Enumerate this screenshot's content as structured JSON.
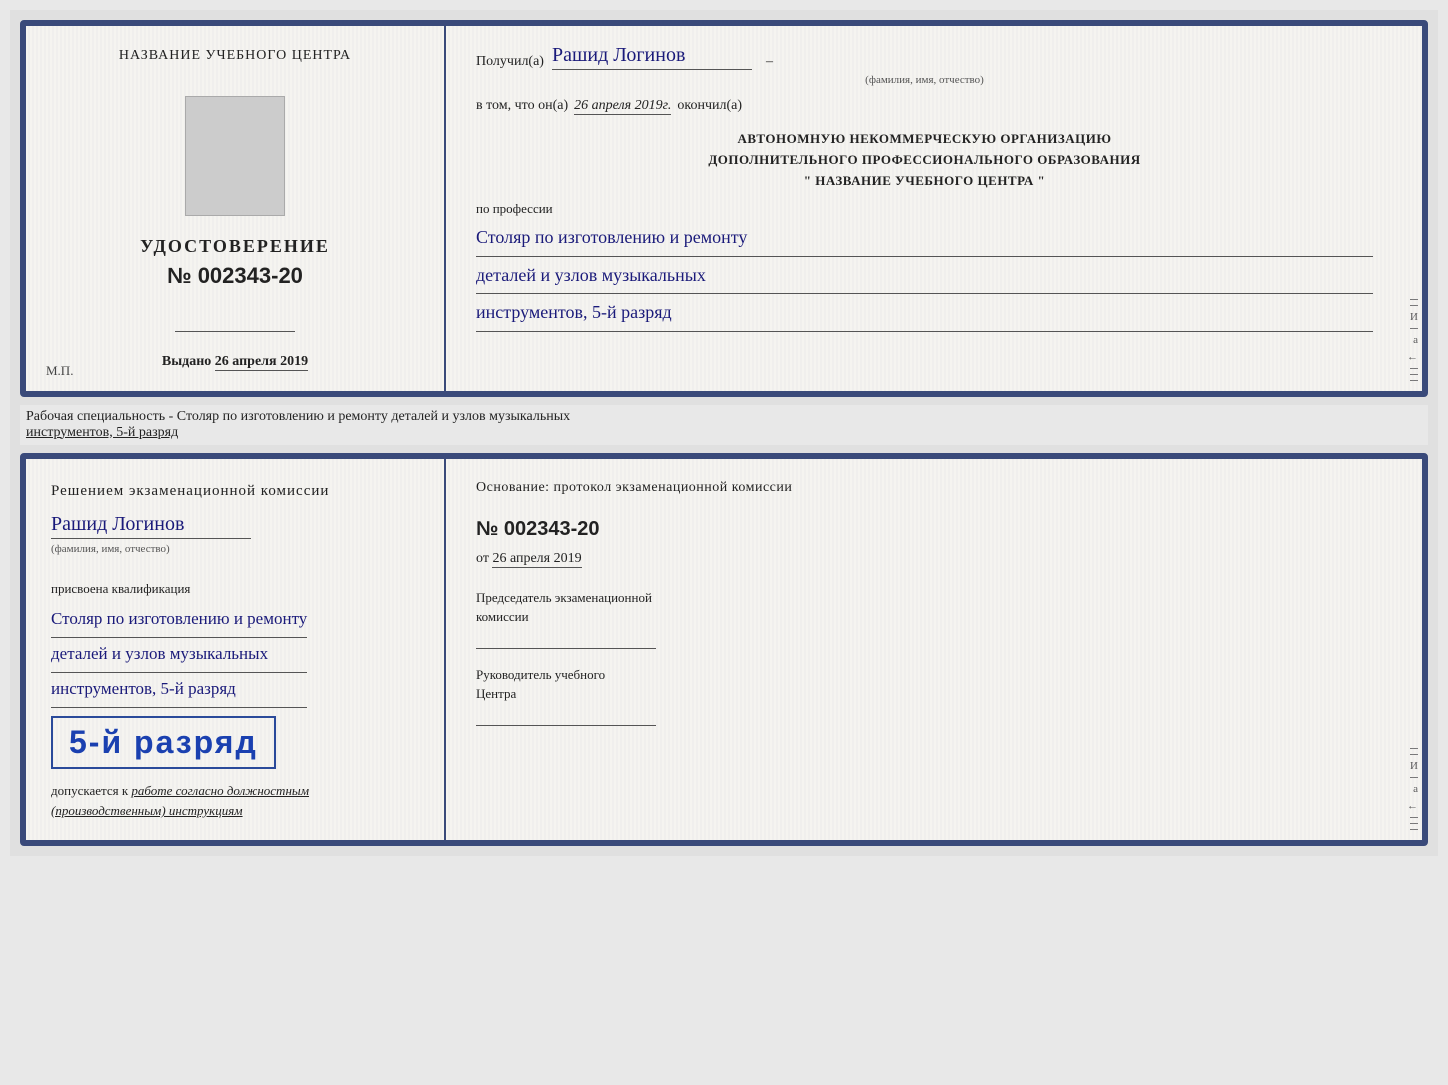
{
  "page": {
    "background_color": "#e0e0e0"
  },
  "top_document": {
    "left": {
      "center_title": "НАЗВАНИЕ УЧЕБНОГО ЦЕНТРА",
      "cert_label": "УДОСТОВЕРЕНИЕ",
      "cert_number": "№ 002343-20",
      "issued_prefix": "Выдано",
      "issued_date": "26 апреля 2019",
      "mp_label": "М.П."
    },
    "right": {
      "received_prefix": "Получил(а)",
      "recipient_name": "Рашид Логинов",
      "name_subtitle": "(фамилия, имя, отчество)",
      "in_that_prefix": "в том, что он(а)",
      "in_that_date": "26 апреля 2019г.",
      "finished_label": "окончил(а)",
      "org_line1": "АВТОНОМНУЮ НЕКОММЕРЧЕСКУЮ ОРГАНИЗАЦИЮ",
      "org_line2": "ДОПОЛНИТЕЛЬНОГО ПРОФЕССИОНАЛЬНОГО ОБРАЗОВАНИЯ",
      "org_line3": "\"  НАЗВАНИЕ УЧЕБНОГО ЦЕНТРА  \"",
      "profession_prefix": "по профессии",
      "profession_line1": "Столяр по изготовлению и ремонту",
      "profession_line2": "деталей и узлов музыкальных",
      "profession_line3": "инструментов, 5-й разряд"
    }
  },
  "between_label": {
    "text_plain": "Рабочая специальность - Столяр по изготовлению и ремонту деталей и узлов музыкальных",
    "text_underline": "инструментов, 5-й разряд"
  },
  "bottom_document": {
    "left": {
      "commission_title": "Решением  экзаменационной  комиссии",
      "recipient_name": "Рашид Логинов",
      "name_subtitle": "(фамилия, имя, отчество)",
      "assigned_label": "присвоена квалификация",
      "qualification_line1": "Столяр по изготовлению и ремонту",
      "qualification_line2": "деталей и узлов музыкальных",
      "qualification_line3": "инструментов, 5-й разряд",
      "rank_text": "5-й разряд",
      "admits_prefix": "допускается к",
      "admits_text": "работе согласно должностным",
      "admits_text2": "(производственным) инструкциям"
    },
    "right": {
      "basis_label": "Основание: протокол экзаменационной  комиссии",
      "protocol_number": "№  002343-20",
      "from_prefix": "от",
      "from_date": "26 апреля 2019",
      "chairman_title": "Председатель экзаменационной",
      "chairman_title2": "комиссии",
      "director_title": "Руководитель учебного",
      "director_title2": "Центра"
    }
  },
  "edge_letters": {
    "letter_i": "И",
    "letter_a": "а",
    "letter_arrow": "←"
  }
}
